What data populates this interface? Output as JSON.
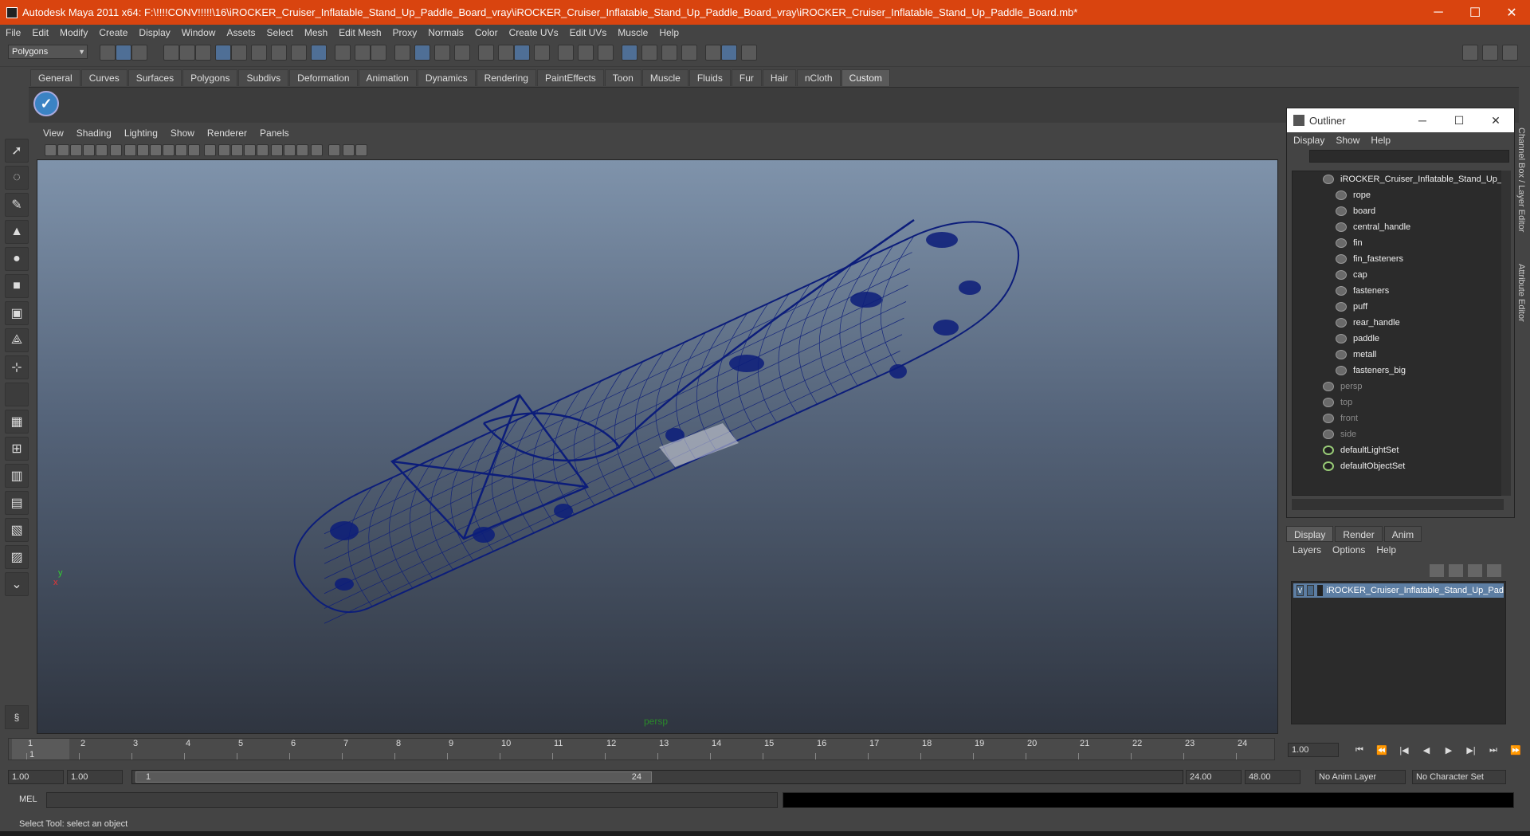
{
  "titlebar": {
    "title": "Autodesk Maya 2011 x64: F:\\!!!!CONV!!!!!\\16\\iROCKER_Cruiser_Inflatable_Stand_Up_Paddle_Board_vray\\iROCKER_Cruiser_Inflatable_Stand_Up_Paddle_Board_vray\\iROCKER_Cruiser_Inflatable_Stand_Up_Paddle_Board.mb*",
    "minimize": "─",
    "maximize": "☐",
    "close": "✕"
  },
  "menubar": [
    "File",
    "Edit",
    "Modify",
    "Create",
    "Display",
    "Window",
    "Assets",
    "Select",
    "Mesh",
    "Edit Mesh",
    "Proxy",
    "Normals",
    "Color",
    "Create UVs",
    "Edit UVs",
    "Muscle",
    "Help"
  ],
  "status": {
    "mode": "Polygons"
  },
  "shelf_tabs": [
    "General",
    "Curves",
    "Surfaces",
    "Polygons",
    "Subdivs",
    "Deformation",
    "Animation",
    "Dynamics",
    "Rendering",
    "PaintEffects",
    "Toon",
    "Muscle",
    "Fluids",
    "Fur",
    "Hair",
    "nCloth",
    "Custom"
  ],
  "shelf_active": "Custom",
  "panel_menu": [
    "View",
    "Shading",
    "Lighting",
    "Show",
    "Renderer",
    "Panels"
  ],
  "viewport": {
    "camera_label": "persp",
    "axis_x": "x",
    "axis_y": "y"
  },
  "outliner": {
    "title": "Outliner",
    "menu": [
      "Display",
      "Show",
      "Help"
    ],
    "root": "iROCKER_Cruiser_Inflatable_Stand_Up_",
    "children": [
      "rope",
      "board",
      "central_handle",
      "fin",
      "fin_fasteners",
      "cap",
      "fasteners",
      "puff",
      "rear_handle",
      "paddle",
      "metall",
      "fasteners_big"
    ],
    "cameras": [
      "persp",
      "top",
      "front",
      "side"
    ],
    "sets": [
      "defaultLightSet",
      "defaultObjectSet"
    ]
  },
  "layer_editor": {
    "tabs": [
      "Display",
      "Render",
      "Anim"
    ],
    "active_tab": "Display",
    "menu": [
      "Layers",
      "Options",
      "Help"
    ],
    "layer": {
      "visible": "V",
      "name": "iROCKER_Cruiser_Inflatable_Stand_Up_Pad"
    }
  },
  "side_tabs": [
    "Channel Box / Layer Editor",
    "Attribute Editor"
  ],
  "timeline": {
    "ticks": [
      "1",
      "2",
      "3",
      "4",
      "5",
      "6",
      "7",
      "8",
      "9",
      "10",
      "11",
      "12",
      "13",
      "14",
      "15",
      "16",
      "17",
      "18",
      "19",
      "20",
      "21",
      "22",
      "23",
      "24"
    ],
    "current_frame": "1",
    "current_field": "1.00"
  },
  "range": {
    "start": "1.00",
    "start2": "1.00",
    "range_start": "1",
    "range_end": "24",
    "end": "24.00",
    "end2": "48.00",
    "anim_layer": "No Anim Layer",
    "char_set": "No Character Set"
  },
  "playback_buttons": [
    "⏮",
    "⏪",
    "|◀",
    "◀",
    "▶",
    "▶|",
    "⏭",
    "⏩"
  ],
  "mel": {
    "label": "MEL"
  },
  "help_line": "Select Tool: select an object",
  "colors": {
    "titlebar": "#d9440f",
    "wireframe": "#0c1d7a",
    "layer_highlight": "#5d7ea3"
  }
}
